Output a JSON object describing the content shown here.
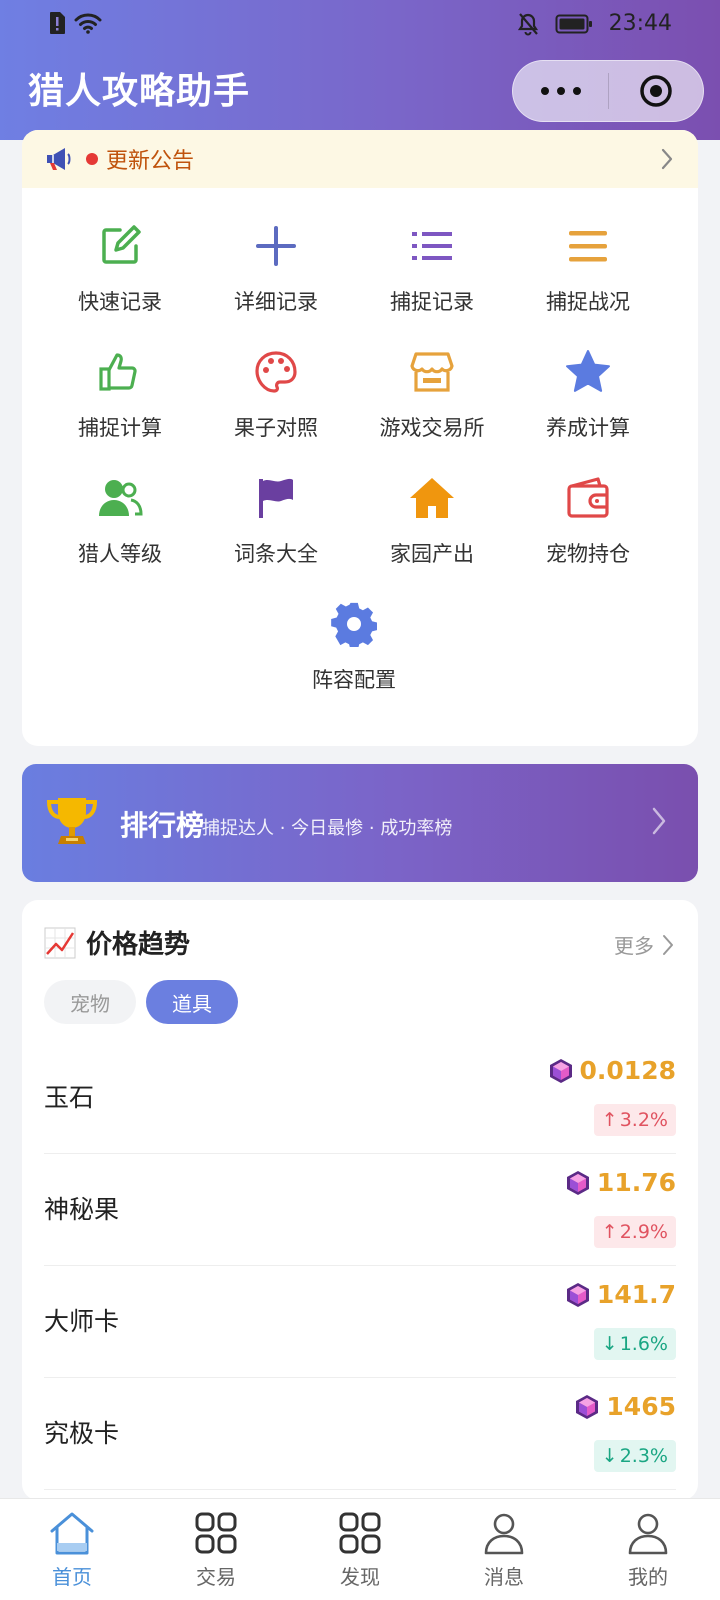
{
  "status_bar": {
    "time": "23:44"
  },
  "header": {
    "title": "猎人攻略助手"
  },
  "notice": {
    "text": "更新公告"
  },
  "menu": [
    {
      "label": "快速记录",
      "icon": "edit-icon",
      "color": "#4caf50"
    },
    {
      "label": "详细记录",
      "icon": "plus-icon",
      "color": "#5c6bc0"
    },
    {
      "label": "捕捉记录",
      "icon": "list-icon",
      "color": "#7e57c2"
    },
    {
      "label": "捕捉战况",
      "icon": "menu-icon",
      "color": "#e6a23c"
    },
    {
      "label": "捕捉计算",
      "icon": "thumbs-up-icon",
      "color": "#4caf50"
    },
    {
      "label": "果子对照",
      "icon": "palette-icon",
      "color": "#e04848"
    },
    {
      "label": "游戏交易所",
      "icon": "store-icon",
      "color": "#e6a23c"
    },
    {
      "label": "养成计算",
      "icon": "star-icon",
      "color": "#5b7be0"
    },
    {
      "label": "猎人等级",
      "icon": "users-icon",
      "color": "#4caf50"
    },
    {
      "label": "词条大全",
      "icon": "flag-icon",
      "color": "#6a3fa0"
    },
    {
      "label": "家园产出",
      "icon": "home-icon",
      "color": "#f0960e"
    },
    {
      "label": "宠物持仓",
      "icon": "wallet-icon",
      "color": "#e04848"
    },
    {
      "label": "阵容配置",
      "icon": "gear-icon",
      "color": "#5b7be0"
    }
  ],
  "ranking": {
    "title": "排行榜",
    "subtitle": "捕捉达人 · 今日最惨 · 成功率榜"
  },
  "price_trend": {
    "title": "价格趋势",
    "more": "更多",
    "tabs": [
      {
        "label": "宠物",
        "active": false
      },
      {
        "label": "道具",
        "active": true
      }
    ],
    "items": [
      {
        "name": "玉石",
        "price": "0.0128",
        "change": "3.2%",
        "direction": "up"
      },
      {
        "name": "神秘果",
        "price": "11.76",
        "change": "2.9%",
        "direction": "up"
      },
      {
        "name": "大师卡",
        "price": "141.7",
        "change": "1.6%",
        "direction": "down"
      },
      {
        "name": "究极卡",
        "price": "1465",
        "change": "2.3%",
        "direction": "down"
      }
    ]
  },
  "tabbar": [
    {
      "label": "首页",
      "icon": "home-outline-icon",
      "active": true
    },
    {
      "label": "交易",
      "icon": "grid-icon",
      "active": false
    },
    {
      "label": "发现",
      "icon": "grid-icon",
      "active": false
    },
    {
      "label": "消息",
      "icon": "user-icon",
      "active": false
    },
    {
      "label": "我的",
      "icon": "user-icon",
      "active": false
    }
  ],
  "colors": {
    "accent": "#6b7fe0",
    "price": "#e8a22a",
    "up": "#e05360",
    "down": "#1aa683"
  }
}
